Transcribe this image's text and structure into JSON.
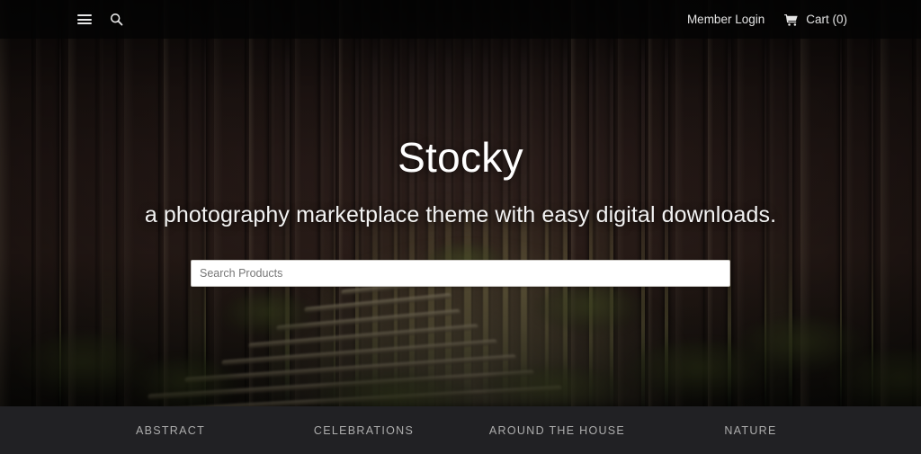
{
  "topbar": {
    "menu_icon": "hamburger-menu-icon",
    "search_icon": "search-icon",
    "member_login_label": "Member Login",
    "cart_icon": "shopping-cart-icon",
    "cart_label": "Cart (0)"
  },
  "hero": {
    "title": "Stocky",
    "subtitle": "a photography marketplace theme with easy digital downloads.",
    "search_placeholder": "Search Products",
    "search_value": "",
    "background_description": "forest path with tall tree trunks and log steps"
  },
  "categories": {
    "items": [
      {
        "label": "Abstract"
      },
      {
        "label": "Celebrations"
      },
      {
        "label": "Around the House"
      },
      {
        "label": "Nature"
      }
    ]
  },
  "colors": {
    "topbar_bg": "#040404",
    "catbar_bg": "#212124",
    "cat_text": "#adadad",
    "hero_text": "#ffffff",
    "search_bg": "#ffffff"
  }
}
